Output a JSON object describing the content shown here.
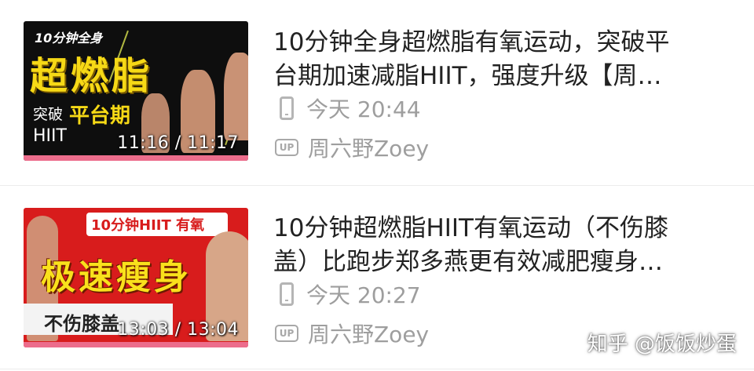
{
  "videos": [
    {
      "thumb": {
        "top_text": "10分钟全身",
        "big_text": "超燃脂",
        "sub_text_a": "突破",
        "sub_text_b": "平台期",
        "sub_text_c": "HIIT",
        "duration": "11:16 / 11:17",
        "progress_fraction": 1.0
      },
      "title_line1": "10分钟全身超燃脂有氧运动，突破平",
      "title_line2": "台期加速减脂HIIT，强度升级【周…",
      "time": "今天 20:44",
      "uploader": "周六野Zoey"
    },
    {
      "thumb": {
        "top_text": "10分钟HIIT 有氧",
        "big_text": "极速瘦身",
        "sub_text": "不伤膝盖",
        "duration": "13:03 / 13:04",
        "progress_fraction": 1.0
      },
      "title_line1": "10分钟超燃脂HIIT有氧运动（不伤膝",
      "title_line2": "盖）比跑步郑多燕更有效减肥瘦身…",
      "time": "今天 20:27",
      "uploader": "周六野Zoey"
    }
  ],
  "icons": {
    "device": "phone-icon",
    "uploader": "up-badge-icon",
    "up_badge_text": "UP"
  },
  "colors": {
    "progress": "#ec6d8c",
    "thumb1_accent": "#f6d916",
    "thumb2_bg": "#d81c1c",
    "meta_text": "#9e9e9e",
    "title_text": "#222222"
  },
  "watermark": "知乎 @饭饭炒蛋"
}
